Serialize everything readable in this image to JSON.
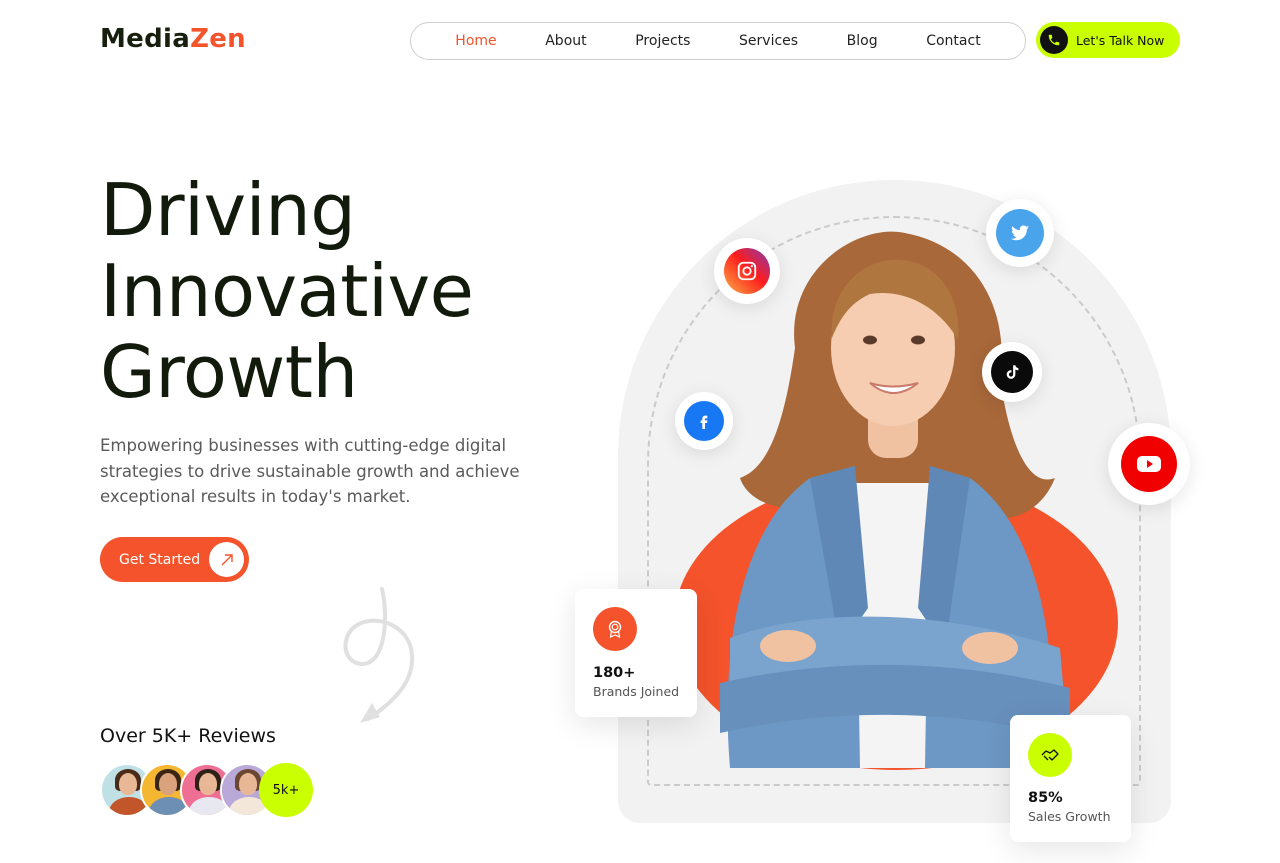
{
  "header": {
    "logo_prefix": "Media",
    "logo_accent": "Zen",
    "nav": [
      "Home",
      "About",
      "Projects",
      "Services",
      "Blog",
      "Contact"
    ],
    "active_nav": "Home",
    "cta_label": "Let's Talk Now"
  },
  "hero": {
    "headline": [
      "Driving",
      "Innovative",
      "Growth"
    ],
    "subtitle": "Empowering businesses with cutting-edge digital strategies to drive sustainable growth and achieve exceptional results in today's market.",
    "button_label": "Get Started"
  },
  "reviews": {
    "title": "Over 5K+ Reviews",
    "count_badge": "5k+"
  },
  "stats": {
    "brands": {
      "value": "180+",
      "label": "Brands Joined"
    },
    "sales": {
      "value": "85%",
      "label": "Sales Growth"
    }
  },
  "social_icons": [
    "instagram-icon",
    "twitter-icon",
    "tiktok-icon",
    "facebook-icon",
    "youtube-icon"
  ],
  "colors": {
    "accent": "#f4532b",
    "lime": "#c9ff00",
    "dark": "#111a0b"
  }
}
